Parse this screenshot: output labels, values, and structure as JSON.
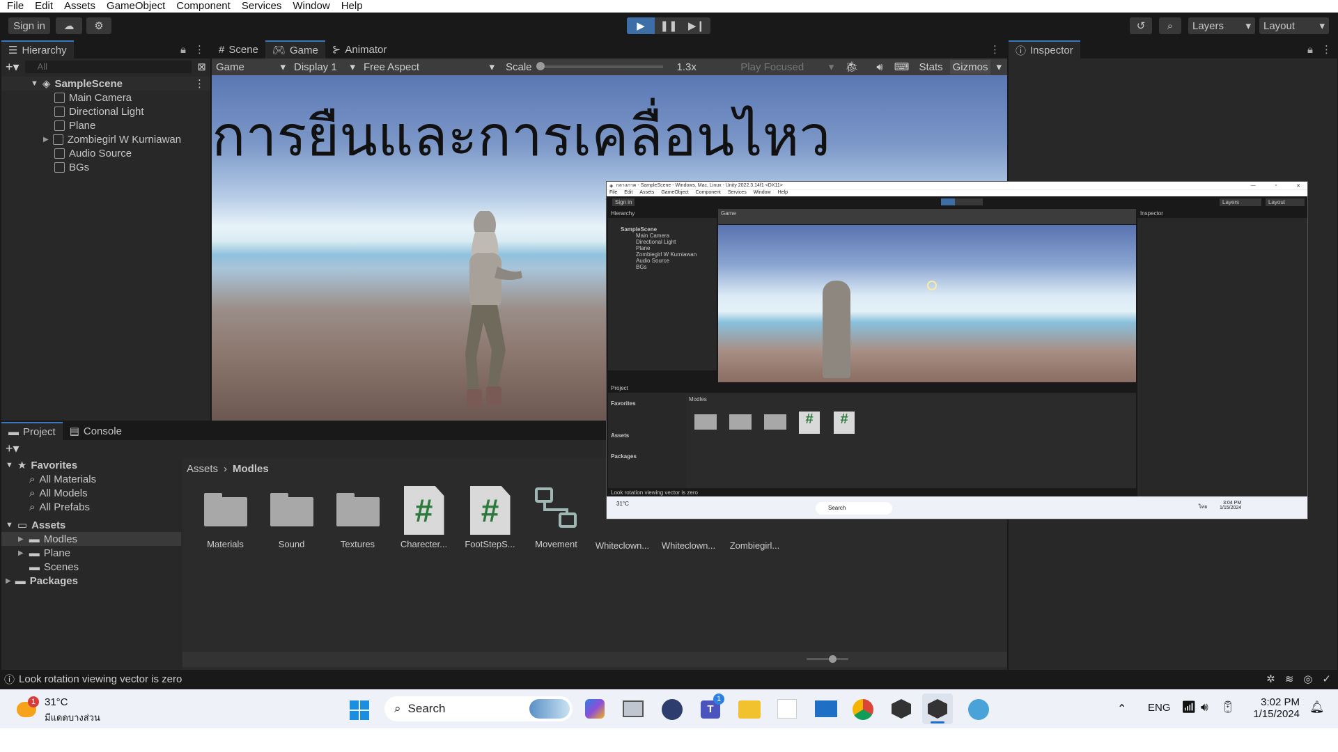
{
  "menubar": {
    "items": [
      "File",
      "Edit",
      "Assets",
      "GameObject",
      "Component",
      "Services",
      "Window",
      "Help"
    ]
  },
  "toolbar": {
    "sign_in": "Sign in",
    "layers": "Layers",
    "layout": "Layout"
  },
  "hierarchy": {
    "tab": "Hierarchy",
    "search_placeholder": "All",
    "scene": "SampleScene",
    "items": [
      "Main Camera",
      "Directional Light",
      "Plane",
      "Zombiegirl W Kurniawan",
      "Audio Source",
      "BGs"
    ]
  },
  "view_tabs": {
    "scene": "Scene",
    "game": "Game",
    "animator": "Animator"
  },
  "game_bar": {
    "mode": "Game",
    "display": "Display 1",
    "aspect": "Free Aspect",
    "scale_label": "Scale",
    "scale_value": "1.3x",
    "play_focused": "Play Focused",
    "stats": "Stats",
    "gizmos": "Gizmos"
  },
  "game_overlay_text": "การยืนและการเคลื่อนไหว",
  "inspector": {
    "tab": "Inspector"
  },
  "project": {
    "tabs": [
      "Project",
      "Console"
    ],
    "favorites": {
      "label": "Favorites",
      "items": [
        "All Materials",
        "All Models",
        "All Prefabs"
      ]
    },
    "assets": {
      "label": "Assets",
      "items": [
        "Modles",
        "Plane",
        "Scenes"
      ]
    },
    "packages": "Packages",
    "breadcrumb": [
      "Assets",
      "Modles"
    ],
    "grid": [
      {
        "type": "folder",
        "label": "Materials"
      },
      {
        "type": "folder",
        "label": "Sound"
      },
      {
        "type": "folder",
        "label": "Textures"
      },
      {
        "type": "script",
        "label": "Charecter..."
      },
      {
        "type": "script",
        "label": "FootStepS..."
      },
      {
        "type": "anim",
        "label": "Movement"
      },
      {
        "type": "prefab",
        "label": "Whiteclown..."
      },
      {
        "type": "prefab",
        "label": "Whiteclown..."
      },
      {
        "type": "model",
        "label": "Zombiegirl..."
      }
    ]
  },
  "status": {
    "message": "Look rotation viewing vector is zero"
  },
  "taskbar": {
    "weather_temp": "31°C",
    "weather_desc": "มีแดดบางส่วน",
    "weather_badge": "1",
    "search": "Search",
    "teams_badge": "1",
    "lang": "ENG",
    "time": "3:02 PM",
    "date": "1/15/2024"
  },
  "mini": {
    "title": "กลางภาค - SampleScene - Windows, Mac, Linux - Unity 2022.3.14f1 <DX11>",
    "time": "3:04 PM",
    "date": "1/15/2024",
    "lang": "ไทย"
  },
  "colors": {
    "accent": "#3a79bb",
    "play_active": "#3d6fa6",
    "editor_bg": "#191919",
    "panel": "#282828"
  }
}
